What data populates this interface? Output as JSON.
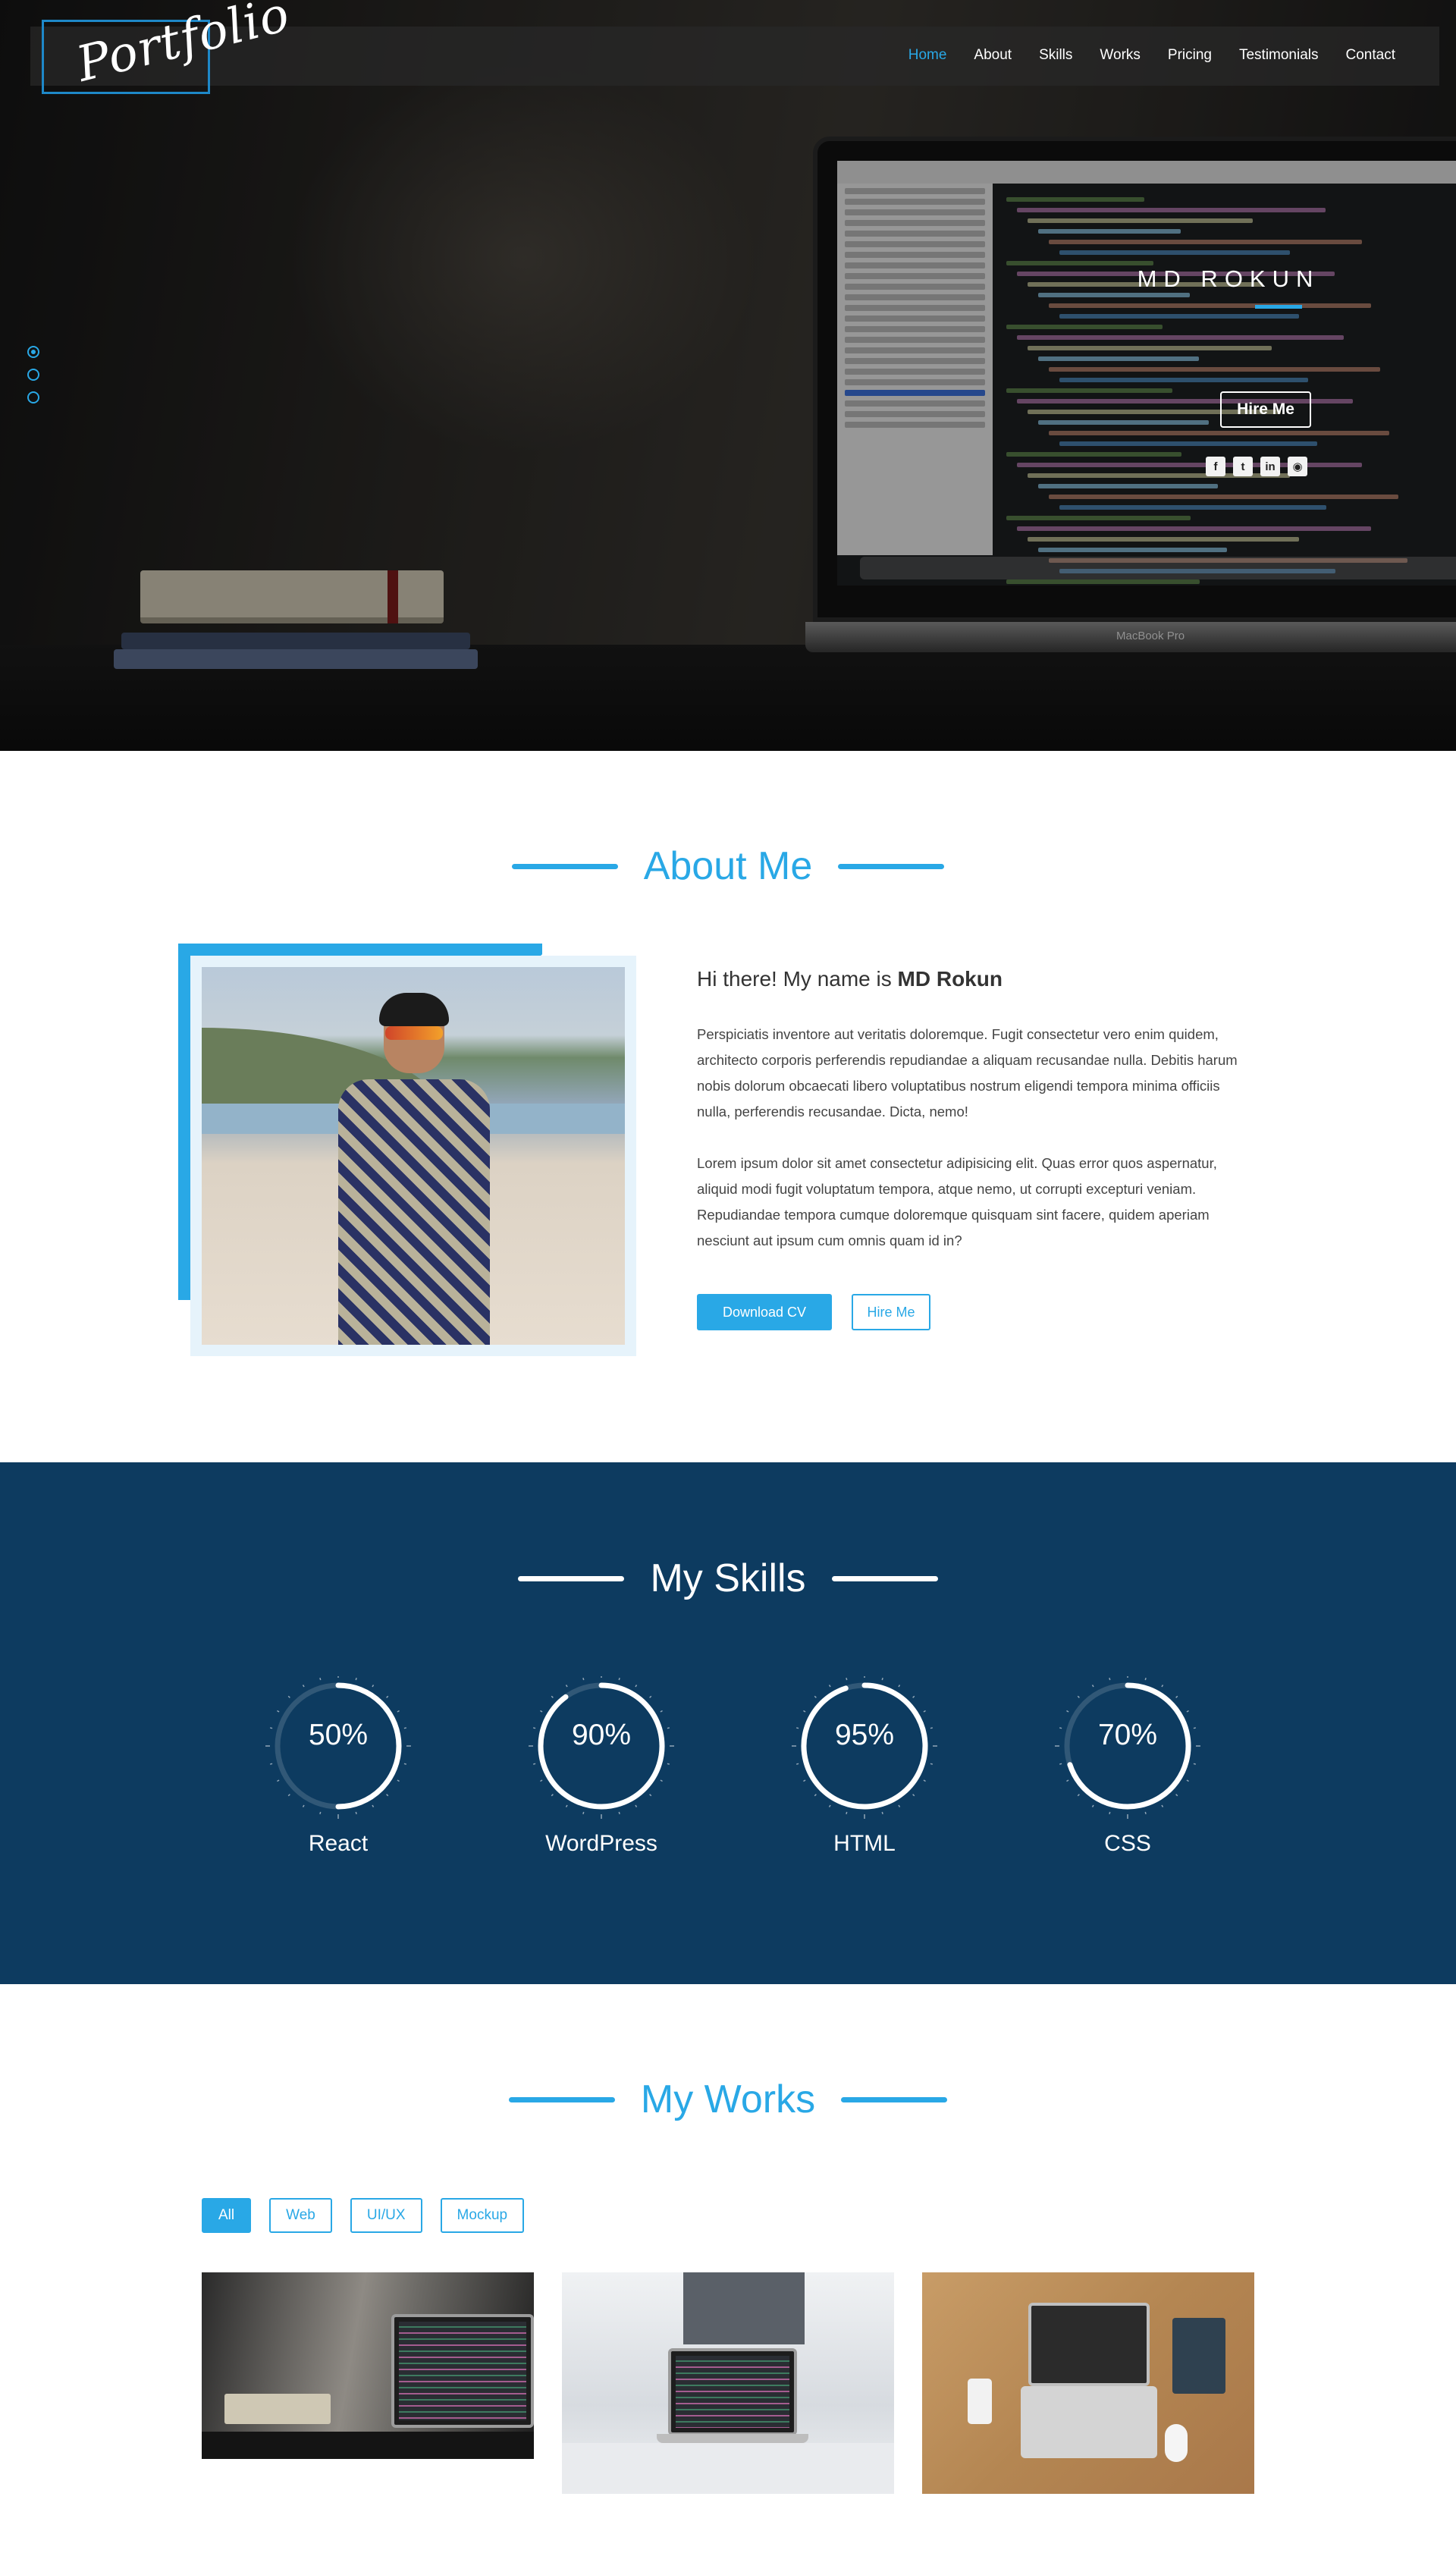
{
  "nav": {
    "logo": "Portfolio",
    "items": [
      "Home",
      "About",
      "Skills",
      "Works",
      "Pricing",
      "Testimonials",
      "Contact"
    ],
    "active": "Home"
  },
  "hero": {
    "name": "MD ROKUN",
    "cta": "Hire Me",
    "laptop_brand": "MacBook Pro",
    "social_icons": [
      "facebook-icon",
      "twitter-icon",
      "linkedin-icon",
      "github-icon"
    ],
    "slide_count": 3,
    "active_slide": 1
  },
  "about": {
    "title": "About Me",
    "greeting_prefix": "Hi there! My name is ",
    "greeting_name": "MD Rokun",
    "paragraph1": "Perspiciatis inventore aut veritatis doloremque. Fugit consectetur vero enim quidem, architecto corporis perferendis repudiandae a aliquam recusandae nulla. Debitis harum nobis dolorum obcaecati libero voluptatibus nostrum eligendi tempora minima officiis nulla, perferendis recusandae. Dicta, nemo!",
    "paragraph2": "Lorem ipsum dolor sit amet consectetur adipisicing elit. Quas error quos aspernatur, aliquid modi fugit voluptatum tempora, atque nemo, ut corrupti excepturi veniam. Repudiandae tempora cumque doloremque quisquam sint facere, quidem aperiam nesciunt aut ipsum cum omnis quam id in?",
    "btn_download": "Download CV",
    "btn_hire": "Hire Me"
  },
  "skills": {
    "title": "My Skills",
    "items": [
      {
        "label": "50%",
        "name": "React",
        "value": 50
      },
      {
        "label": "90%",
        "name": "WordPress",
        "value": 90
      },
      {
        "label": "95%",
        "name": "HTML",
        "value": 95
      },
      {
        "label": "70%",
        "name": "CSS",
        "value": 70
      }
    ]
  },
  "works": {
    "title": "My Works",
    "filters": [
      "All",
      "Web",
      "UI/UX",
      "Mockup"
    ],
    "active_filter": "All"
  },
  "colors": {
    "accent": "#29a8e6",
    "skills_bg": "#0d3b60",
    "white": "#ffffff"
  }
}
